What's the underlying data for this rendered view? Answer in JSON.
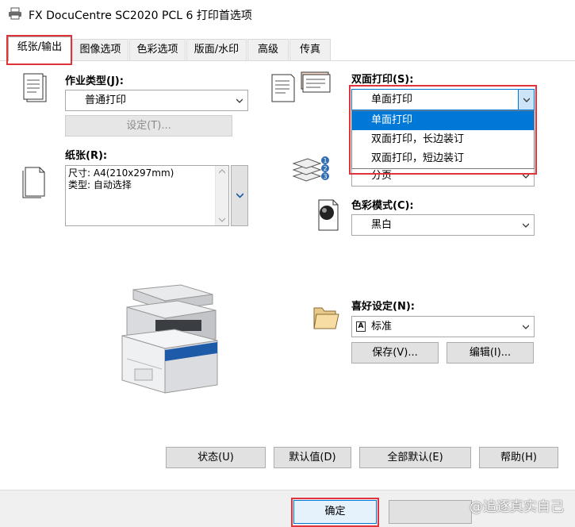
{
  "window": {
    "title": "FX DocuCentre SC2020 PCL 6 打印首选项"
  },
  "tabs": [
    {
      "label": "纸张/输出",
      "active": true
    },
    {
      "label": "图像选项"
    },
    {
      "label": "色彩选项"
    },
    {
      "label": "版面/水印"
    },
    {
      "label": "高级"
    },
    {
      "label": "传真"
    }
  ],
  "job_type": {
    "label": "作业类型(J):",
    "value": "普通打印",
    "settings_button": "设定(T)..."
  },
  "paper": {
    "label": "纸张(R):",
    "lines": [
      "尺寸: A4(210x297mm)",
      "类型: 自动选择"
    ]
  },
  "duplex": {
    "label": "双面打印(S):",
    "value": "单面打印",
    "options": [
      "单面打印",
      "双面打印，长边装订",
      "双面打印，短边装订"
    ]
  },
  "collate": {
    "value": "分页"
  },
  "color_mode": {
    "label": "色彩模式(C):",
    "value": "黑白"
  },
  "favorites": {
    "label": "喜好设定(N):",
    "value": "标准",
    "save_button": "保存(V)...",
    "edit_button": "编辑(I)..."
  },
  "footer_buttons": {
    "status": "状态(U)",
    "default": "默认值(D)",
    "all_default": "全部默认(E)",
    "help": "帮助(H)"
  },
  "dialog_buttons": {
    "ok": "确定"
  },
  "watermark": "@追逐真实自己",
  "colors": {
    "highlight": "#0078d7",
    "annotation_red": "#e0333b"
  }
}
